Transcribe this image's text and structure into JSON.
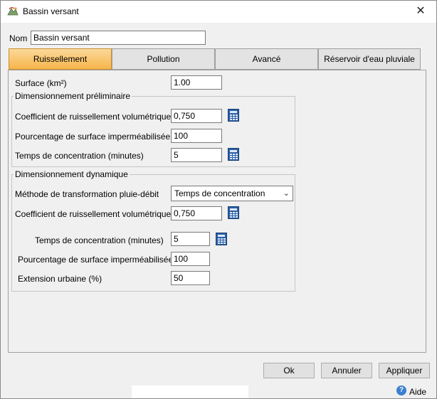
{
  "window": {
    "title": "Bassin versant",
    "close_glyph": "✕"
  },
  "name_field": {
    "label": "Nom",
    "value": "Bassin versant"
  },
  "tabs": [
    {
      "label": "Ruissellement",
      "active": true
    },
    {
      "label": "Pollution",
      "active": false
    },
    {
      "label": "Avancé",
      "active": false
    },
    {
      "label": "Réservoir d'eau pluviale",
      "active": false
    }
  ],
  "runoff": {
    "surface": {
      "label": "Surface (km²)",
      "value": "1.00"
    },
    "preliminary": {
      "title": "Dimensionnement préliminaire",
      "coef": {
        "label": "Coefficient de ruissellement volumétrique",
        "value": "0,750"
      },
      "impervious": {
        "label": "Pourcentage de surface imperméabilisée (%)",
        "value": "100"
      },
      "tc": {
        "label": "Temps de concentration (minutes)",
        "value": "5"
      }
    },
    "dynamic": {
      "title": "Dimensionnement dynamique",
      "method": {
        "label": "Méthode de transformation pluie-débit",
        "value": "Temps de concentration"
      },
      "coef": {
        "label": "Coefficient de ruissellement volumétrique",
        "value": "0,750"
      },
      "tc": {
        "label": "Temps de concentration (minutes)",
        "value": "5"
      },
      "impervious": {
        "label": "Pourcentage de surface imperméabilisée (%)",
        "value": "100"
      },
      "urban": {
        "label": "Extension urbaine (%)",
        "value": "50"
      }
    }
  },
  "buttons": {
    "ok": "Ok",
    "cancel": "Annuler",
    "apply": "Appliquer",
    "help": "Aide"
  },
  "icons": {
    "app": "app-window-icon",
    "calculator": "calculator-icon",
    "help": "help-icon",
    "dropdown": "chevron-down-icon"
  },
  "colors": {
    "active_tab": "#f7b54a",
    "calculator": "#2b5fa5",
    "help": "#3c7fd0"
  }
}
